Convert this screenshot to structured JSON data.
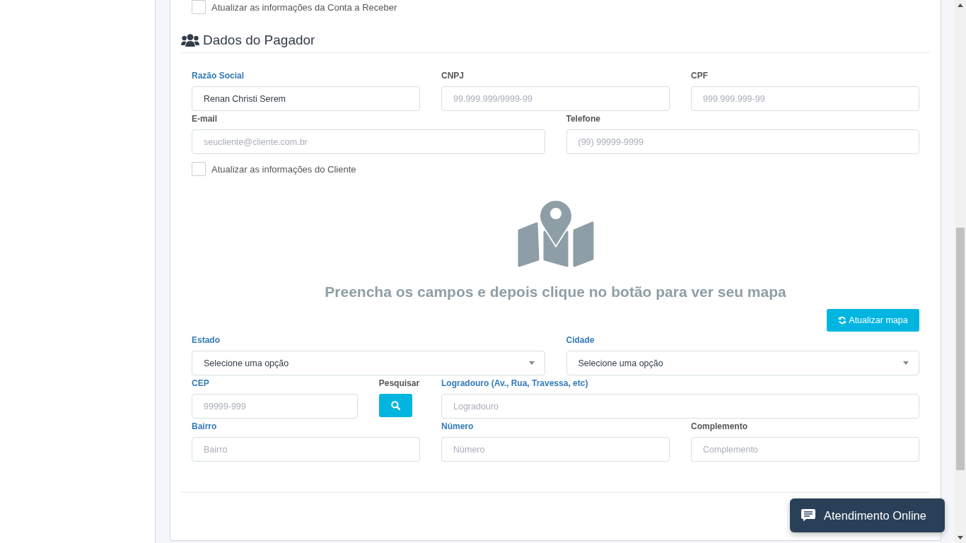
{
  "top_option": {
    "label": "Atualizar as informações da Conta a Receber",
    "checked": false
  },
  "section": {
    "title": "Dados do Pagador"
  },
  "payer_rows": [
    [
      {
        "kind": "input",
        "label": "Razão Social",
        "highlighted": true,
        "value": "Renan Christi Serem"
      },
      {
        "kind": "input",
        "label": "CNPJ",
        "highlighted": false,
        "placeholder": "99.999.999/9999-99"
      },
      {
        "kind": "input",
        "label": "CPF",
        "highlighted": false,
        "placeholder": "999.999.999-99"
      }
    ],
    [
      {
        "kind": "input",
        "label": "E-mail",
        "highlighted": false,
        "placeholder": "seucliente@cliente.com.br"
      },
      {
        "kind": "input",
        "label": "Telefone",
        "highlighted": false,
        "placeholder": "(99) 99999-9999"
      }
    ]
  ],
  "client_option": {
    "label": "Atualizar as informações do Cliente",
    "checked": false
  },
  "map_panel": {
    "message": "Preencha os campos e depois clique no botão para ver seu mapa",
    "button": "Atualizar mapa"
  },
  "address_rows": [
    [
      {
        "kind": "select",
        "label": "Estado",
        "highlighted": true,
        "value": "Selecione uma opção"
      },
      {
        "kind": "select",
        "label": "Cidade",
        "highlighted": true,
        "value": "Selecione uma opção"
      }
    ],
    [
      {
        "kind": "input",
        "label": "CEP",
        "highlighted": true,
        "placeholder": "99999-999"
      },
      {
        "kind": "search",
        "label": "Pesquisar",
        "highlighted": false
      },
      {
        "kind": "input",
        "label": "Logradouro (Av., Rua, Travessa, etc)",
        "highlighted": true,
        "placeholder": "Logradouro"
      }
    ],
    [
      {
        "kind": "input",
        "label": "Bairro",
        "highlighted": true,
        "placeholder": "Bairro"
      },
      {
        "kind": "input",
        "label": "Número",
        "highlighted": true,
        "placeholder": "Número"
      },
      {
        "kind": "input",
        "label": "Complemento",
        "highlighted": false,
        "placeholder": "Complemento"
      }
    ]
  ],
  "chat_button": {
    "label": "Atendimento Online"
  }
}
